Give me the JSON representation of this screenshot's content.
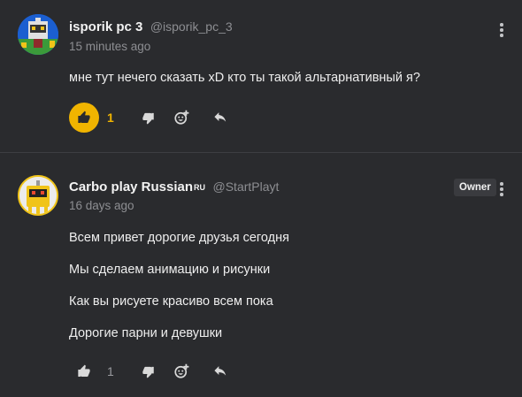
{
  "comments": [
    {
      "author": "isporik pc 3",
      "handle": "@isporik_pc_3",
      "time": "15 minutes ago",
      "lines": [
        "мне тут нечего сказать xD кто ты такой альтарнативный я?"
      ],
      "likes": "1",
      "liked": true,
      "avatar_icon": "pixel-robot-icon"
    },
    {
      "author": "Carbo play Russian",
      "country_badge": "RU",
      "handle": "@StartPlayt",
      "badge": "Owner",
      "time": "16 days ago",
      "lines": [
        "Всем привет дорогие друзья сегодня",
        "Мы сделаем анимацию и рисунки",
        "Как вы рисуете красиво всем пока",
        "Дорогие парни и девушки"
      ],
      "likes": "1",
      "liked": false,
      "avatar_icon": "yellow-robot-icon"
    }
  ],
  "colors": {
    "background": "#2a2b2e",
    "accent": "#f0b400",
    "muted": "#8d8e92"
  },
  "icons": [
    "thumbs-up-icon",
    "thumbs-down-icon",
    "add-reaction-icon",
    "reply-icon",
    "more-options-icon"
  ]
}
